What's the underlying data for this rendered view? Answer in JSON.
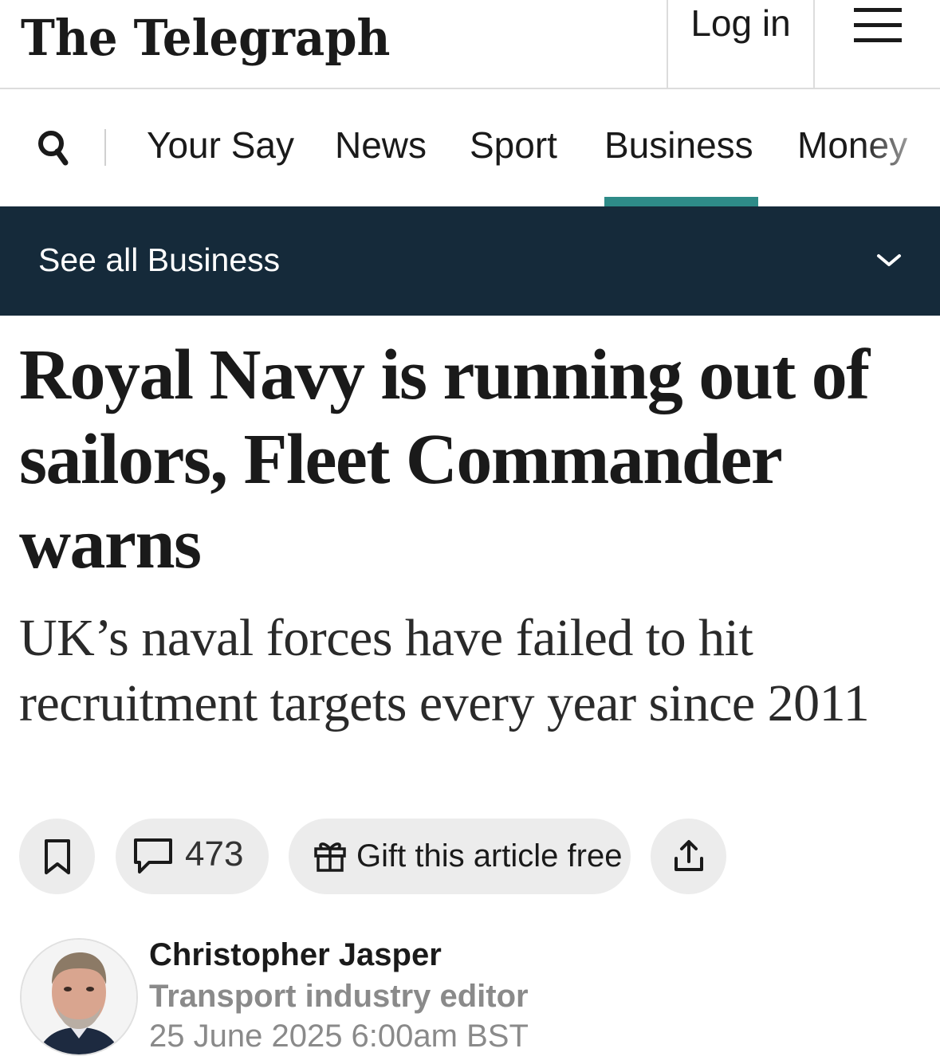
{
  "header": {
    "logo": "The Telegraph",
    "login_label": "Log in",
    "menu_icon": "hamburger-menu-icon"
  },
  "nav": {
    "search_icon": "search-icon",
    "items": [
      {
        "label": "Your Say"
      },
      {
        "label": "News"
      },
      {
        "label": "Sport"
      },
      {
        "label": "Business"
      },
      {
        "label": "Money"
      }
    ],
    "active": "Business",
    "active_color": "#2e8b88"
  },
  "section_bar": {
    "label": "See all Business",
    "icon": "chevron-down-icon",
    "background": "#152a3a"
  },
  "article": {
    "headline": "Royal Navy is running out of sailors, Fleet Commander warns",
    "standfirst": "UK’s naval forces have failed to hit recruitment targets every year since 2011"
  },
  "actions": {
    "bookmark_icon": "bookmark-icon",
    "comment_icon": "comment-icon",
    "comment_count": "473",
    "gift_icon": "gift-icon",
    "gift_label": "Gift this article free",
    "share_icon": "share-icon"
  },
  "byline": {
    "author": "Christopher Jasper",
    "role": "Transport industry editor",
    "date": "25 June 2025 6:00am BST"
  }
}
